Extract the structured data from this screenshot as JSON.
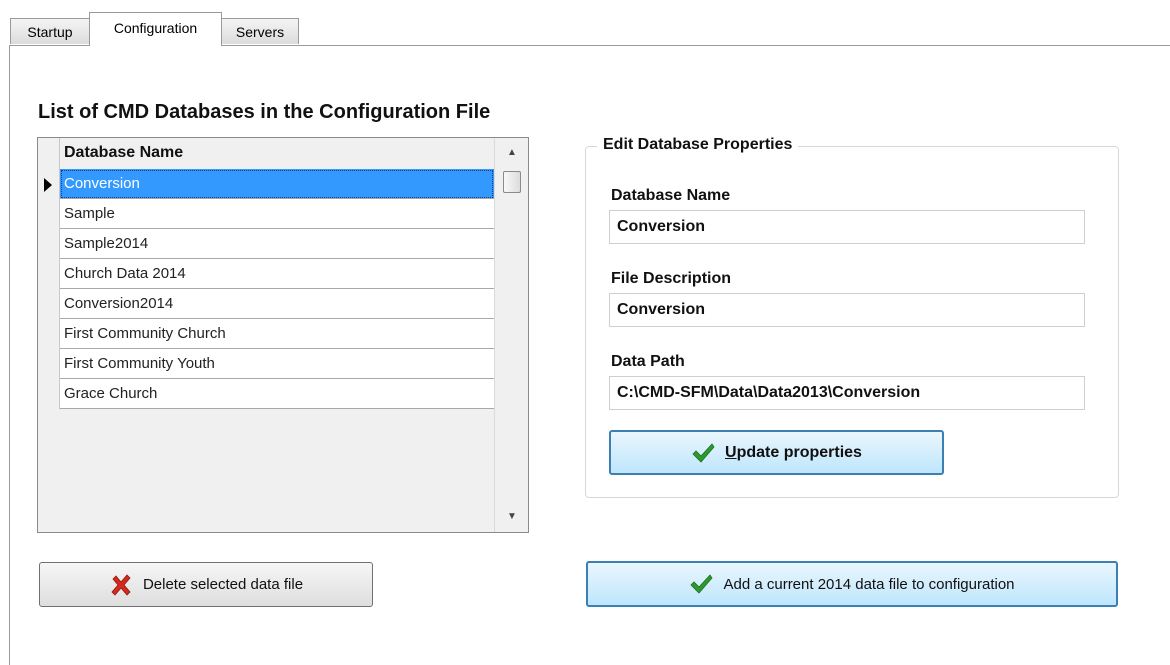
{
  "tabs": [
    {
      "label": "Startup",
      "active": false
    },
    {
      "label": "Configuration",
      "active": true
    },
    {
      "label": "Servers",
      "active": false
    }
  ],
  "list": {
    "title": "List of CMD Databases in the Configuration File",
    "column_header": "Database Name",
    "rows": [
      "Conversion",
      "Sample",
      "Sample2014",
      "Church Data 2014",
      "Conversion2014",
      "First Community Church",
      "First Community Youth",
      "Grace Church"
    ],
    "selected_index": 0
  },
  "edit": {
    "group_title": "Edit Database Properties",
    "database_name_label": "Database Name",
    "database_name_value": "Conversion",
    "file_description_label": "File Description",
    "file_description_value": "Conversion",
    "data_path_label": "Data Path",
    "data_path_value": "C:\\CMD-SFM\\Data\\Data2013\\Conversion",
    "update_button_u": "U",
    "update_button_rest": "pdate properties"
  },
  "buttons": {
    "delete_label": "Delete selected data file",
    "add_label": "Add a current 2014 data file to configuration"
  },
  "icons": {
    "check": "check-icon",
    "delete": "red-x-icon"
  },
  "colors": {
    "selection": "#3399ff",
    "check_green": "#2e9a2e",
    "delete_red": "#d42a1e",
    "focus_border": "#3c7fb1"
  }
}
